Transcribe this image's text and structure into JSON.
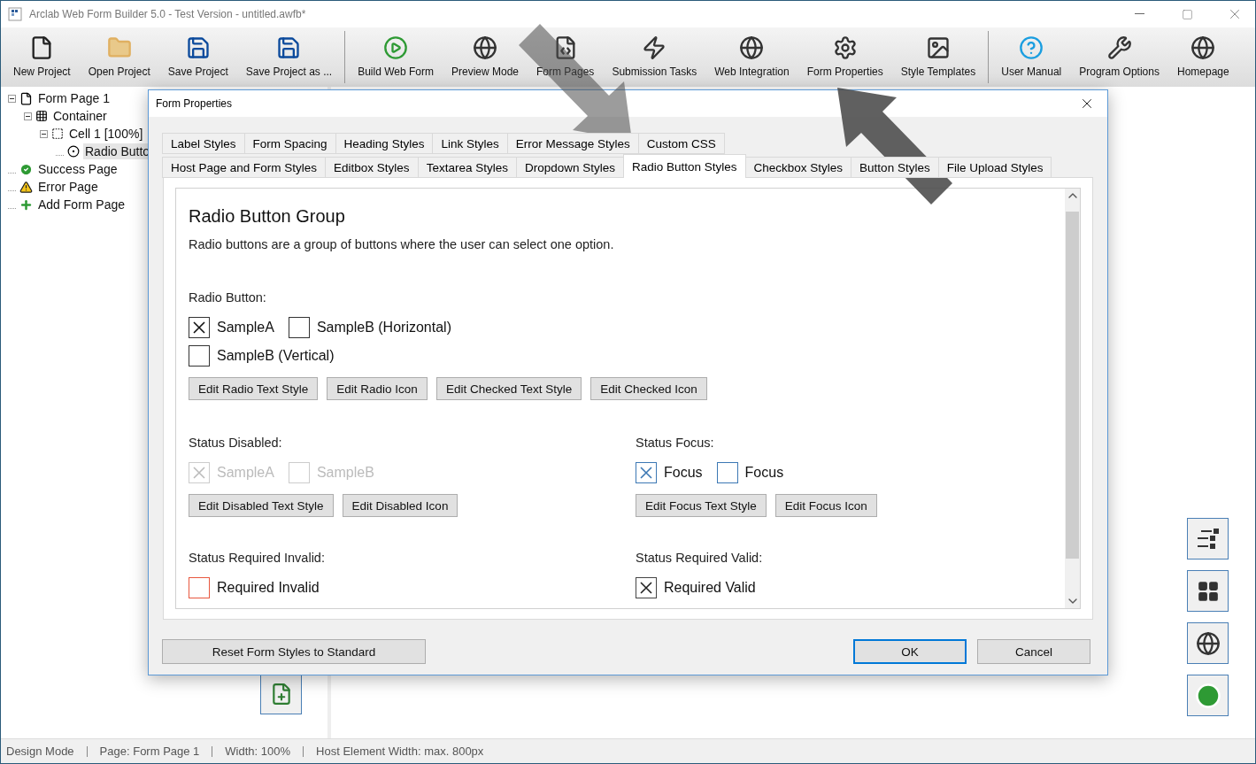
{
  "window": {
    "title": "Arclab Web Form Builder 5.0 - Test Version - untitled.awfb*"
  },
  "toolbar": {
    "groups": [
      [
        {
          "label": "New Project"
        },
        {
          "label": "Open Project"
        },
        {
          "label": "Save Project"
        },
        {
          "label": "Save Project as ..."
        }
      ],
      [
        {
          "label": "Build Web Form"
        },
        {
          "label": "Preview Mode"
        },
        {
          "label": "Form Pages"
        },
        {
          "label": "Submission Tasks"
        },
        {
          "label": "Web Integration"
        },
        {
          "label": "Form Properties"
        },
        {
          "label": "Style Templates"
        }
      ],
      [
        {
          "label": "User Manual"
        },
        {
          "label": "Program Options"
        },
        {
          "label": "Homepage"
        }
      ]
    ]
  },
  "tree": [
    {
      "label": "Form Page 1",
      "kind": "page",
      "selected": false,
      "expanded": true,
      "children": [
        {
          "label": "Container",
          "kind": "container",
          "selected": false,
          "expanded": true,
          "children": [
            {
              "label": "Cell 1 [100%]",
              "kind": "cell",
              "selected": false,
              "expanded": true,
              "children": [
                {
                  "label": "Radio Butto",
                  "kind": "radio",
                  "selected": true
                }
              ]
            }
          ]
        }
      ]
    },
    {
      "label": "Success Page",
      "kind": "success",
      "selected": false
    },
    {
      "label": "Error Page",
      "kind": "error",
      "selected": false
    },
    {
      "label": "Add Form Page",
      "kind": "add",
      "selected": false
    }
  ],
  "dialog": {
    "title": "Form Properties",
    "tabs_back": [
      {
        "label": "Label Styles",
        "selected": false
      },
      {
        "label": "Form Spacing",
        "selected": false
      },
      {
        "label": "Heading Styles",
        "selected": false
      },
      {
        "label": "Link Styles",
        "selected": false
      },
      {
        "label": "Error Message Styles",
        "selected": false
      },
      {
        "label": "Custom CSS",
        "selected": false
      }
    ],
    "tabs_front": [
      {
        "label": "Host Page and Form Styles",
        "selected": false
      },
      {
        "label": "Editbox Styles",
        "selected": false
      },
      {
        "label": "Textarea Styles",
        "selected": false
      },
      {
        "label": "Dropdown Styles",
        "selected": false
      },
      {
        "label": "Radio Button Styles",
        "selected": true
      },
      {
        "label": "Checkbox Styles",
        "selected": false
      },
      {
        "label": "Button Styles",
        "selected": false
      },
      {
        "label": "File Upload Styles",
        "selected": false
      }
    ],
    "heading": "Radio Button Group",
    "description": "Radio buttons are a group of buttons where the user can select one option.",
    "main_section": {
      "label": "Radio Button:",
      "rows": [
        [
          {
            "text": "SampleA",
            "checked": true,
            "kind": "normal"
          },
          {
            "text": "SampleB (Horizontal)",
            "checked": false,
            "kind": "normal"
          }
        ],
        [
          {
            "text": "SampleB (Vertical)",
            "checked": false,
            "kind": "normal"
          }
        ]
      ],
      "buttons": [
        "Edit Radio Text Style",
        "Edit Radio Icon",
        "Edit Checked Text Style",
        "Edit Checked Icon"
      ]
    },
    "sections": [
      {
        "label": "Status Disabled:",
        "samples": [
          {
            "text": "SampleA",
            "checked": true,
            "kind": "disabled"
          },
          {
            "text": "SampleB",
            "checked": false,
            "kind": "disabled"
          }
        ],
        "buttons": [
          "Edit Disabled Text Style",
          "Edit Disabled Icon"
        ]
      },
      {
        "label": "Status Focus:",
        "samples": [
          {
            "text": "Focus",
            "checked": true,
            "kind": "focus"
          },
          {
            "text": "Focus",
            "checked": false,
            "kind": "focus"
          }
        ],
        "buttons": [
          "Edit Focus Text Style",
          "Edit Focus Icon"
        ]
      },
      {
        "label": "Status Required Invalid:",
        "samples": [
          {
            "text": "Required Invalid",
            "checked": false,
            "kind": "invalid"
          }
        ]
      },
      {
        "label": "Status Required Valid:",
        "samples": [
          {
            "text": "Required Valid",
            "checked": true,
            "kind": "valid"
          }
        ]
      }
    ],
    "footer": [
      {
        "label": "Reset Form Styles to Standard",
        "default": false
      },
      {
        "label": "OK",
        "default": true
      },
      {
        "label": "Cancel",
        "default": false
      }
    ]
  },
  "status_bar": [
    "Design Mode",
    "Page: Form Page 1",
    "Width: 100%",
    "Host Element Width: max. 800px"
  ]
}
